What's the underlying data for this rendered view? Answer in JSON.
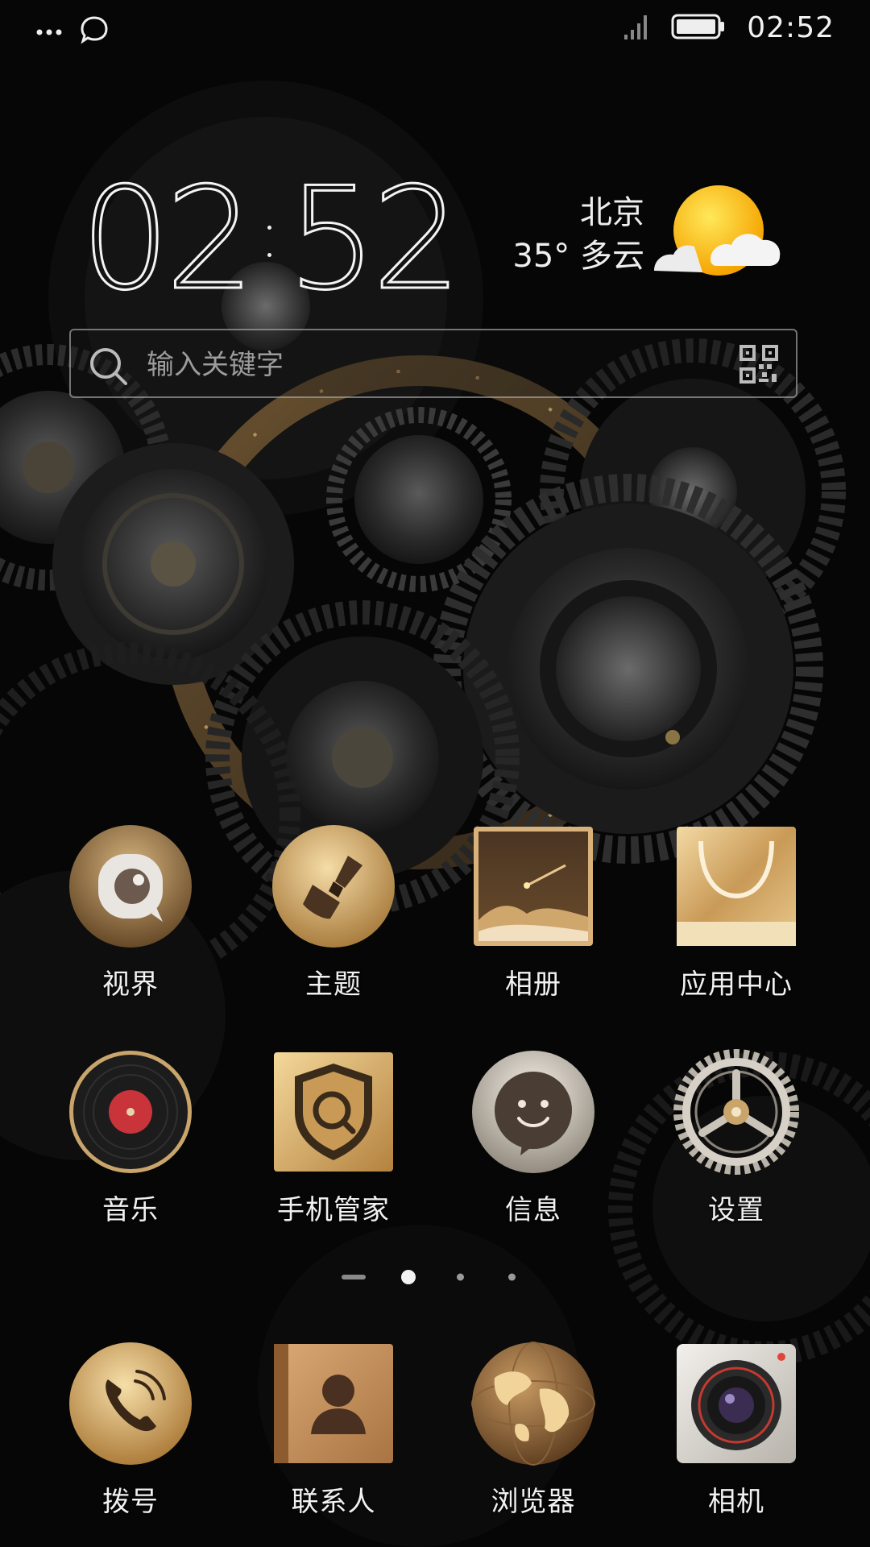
{
  "status_bar": {
    "time": "02:52",
    "icons": [
      "more-dots-icon",
      "chat-bubble-icon",
      "signal-icon",
      "battery-icon"
    ]
  },
  "clock_widget": {
    "hour": "02",
    "minute": "52"
  },
  "weather_widget": {
    "city": "北京",
    "temp_condition": "35° 多云",
    "icon": "sun-cloud-icon"
  },
  "search": {
    "placeholder": "输入关键字",
    "value": ""
  },
  "apps": [
    {
      "label": "视界",
      "icon": "vision-icon"
    },
    {
      "label": "主题",
      "icon": "theme-brush-icon"
    },
    {
      "label": "相册",
      "icon": "gallery-icon"
    },
    {
      "label": "应用中心",
      "icon": "app-store-bag-icon"
    },
    {
      "label": "音乐",
      "icon": "vinyl-record-icon"
    },
    {
      "label": "手机管家",
      "icon": "security-shield-icon"
    },
    {
      "label": "信息",
      "icon": "message-smile-icon"
    },
    {
      "label": "设置",
      "icon": "settings-gear-icon"
    }
  ],
  "page_indicator": {
    "pages": 4,
    "current": 2
  },
  "dock": [
    {
      "label": "拨号",
      "icon": "phone-icon"
    },
    {
      "label": "联系人",
      "icon": "contacts-book-icon"
    },
    {
      "label": "浏览器",
      "icon": "globe-icon"
    },
    {
      "label": "相机",
      "icon": "camera-lens-icon"
    }
  ],
  "colors": {
    "gold": "#d9b070",
    "gold_dark": "#8a6530",
    "background": "#050505",
    "text": "#f1f1f1"
  }
}
